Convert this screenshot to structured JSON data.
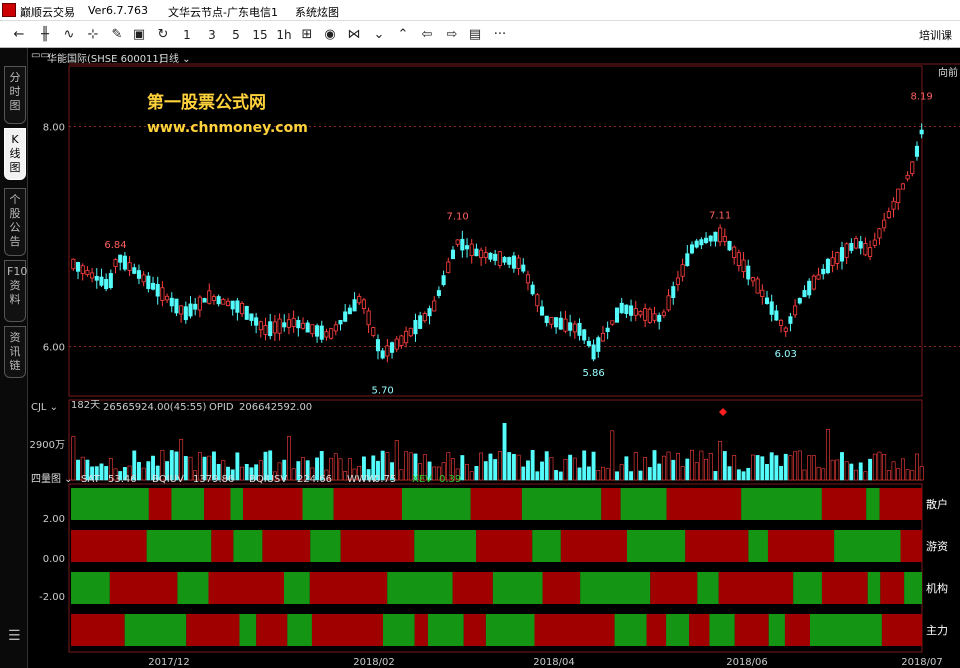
{
  "window": {
    "app_name": "巅顺云交易",
    "version": "Ver6.7.763",
    "server": "文华云节点-广东电信1",
    "theme_label": "系统炫图"
  },
  "toolbar": {
    "period_buttons": [
      "1",
      "3",
      "5",
      "15",
      "1h"
    ],
    "right_label": "培训课",
    "more_label": "···",
    "icons": [
      "back-icon",
      "candlestick-icon",
      "line-chart-icon",
      "crosshair-icon",
      "drawing-tool-icon",
      "save-icon",
      "refresh-icon",
      "period-1",
      "period-3",
      "period-5",
      "period-15",
      "period-1h",
      "grid-icon",
      "eye-icon",
      "bowtie-icon",
      "chevron-down-icon",
      "chevron-up-icon",
      "arrow-left-icon",
      "arrow-right-icon",
      "layout-icon",
      "more-icon"
    ]
  },
  "side_tabs": [
    {
      "label": "分时图",
      "active": false
    },
    {
      "label": "K线图",
      "active": true
    },
    {
      "label": "个股公告",
      "active": false
    },
    {
      "label": "F10资料",
      "active": false
    },
    {
      "label": "资讯链",
      "active": false
    }
  ],
  "header": {
    "symbol": "华能国际(SHSE 600011)",
    "period": "日线",
    "right_label": "向前"
  },
  "watermark": {
    "line1": "第一股票公式网",
    "line2": "www.chnmoney.com"
  },
  "price_panel": {
    "y_ticks": [
      "8.00",
      "6.00"
    ],
    "days_label": "182天",
    "annotations_high": [
      "6.84",
      "7.10",
      "7.11",
      "8.19"
    ],
    "annotations_low": [
      "5.70",
      "5.86",
      "6.03"
    ]
  },
  "volume_panel": {
    "title": "CJL",
    "value": "26565924.00(45:55)",
    "opid_label": "OPID",
    "opid_value": "206642592.00",
    "y_tick": "2900万"
  },
  "indicator_panel": {
    "title": "四量图",
    "items": [
      {
        "name": "SAT",
        "value": "53.46"
      },
      {
        "name": "BQIUV",
        "value": "1379.86"
      },
      {
        "name": "BQIUSV",
        "value": "224.66"
      },
      {
        "name": "WWW",
        "value": "0.75"
      },
      {
        "name": "XEV",
        "value": "0.39"
      }
    ],
    "y_ticks": [
      "2.00",
      "0.00",
      "-2.00"
    ],
    "band_labels": [
      "散户",
      "游资",
      "机构",
      "主力"
    ]
  },
  "x_axis": {
    "labels": [
      "2017/12",
      "2018/02",
      "2018/04",
      "2018/06",
      "2018/07"
    ]
  },
  "colors": {
    "up": "#ff4040",
    "down": "#54fcfc",
    "band_green": "#149614",
    "band_red": "#a00000",
    "watermark": "#ffd23c"
  },
  "chart_data": {
    "type": "candlestick",
    "bar_count": 182,
    "price_ylim": [
      5.7,
      8.19
    ],
    "key_points": [
      {
        "label": "6.84",
        "value": 6.84
      },
      {
        "label": "5.70",
        "value": 5.7
      },
      {
        "label": "7.10",
        "value": 7.1
      },
      {
        "label": "5.86",
        "value": 5.86
      },
      {
        "label": "7.11",
        "value": 7.11
      },
      {
        "label": "6.03",
        "value": 6.03
      },
      {
        "label": "8.19",
        "value": 8.19
      }
    ],
    "price_path_anchors": [
      [
        0,
        6.75
      ],
      [
        9,
        6.55
      ],
      [
        11,
        6.82
      ],
      [
        28,
        6.3
      ],
      [
        34,
        6.45
      ],
      [
        42,
        6.35
      ],
      [
        48,
        6.15
      ],
      [
        55,
        6.22
      ],
      [
        64,
        6.1
      ],
      [
        72,
        6.45
      ],
      [
        77,
        5.92
      ],
      [
        83,
        6.08
      ],
      [
        90,
        6.35
      ],
      [
        96,
        6.95
      ],
      [
        101,
        6.85
      ],
      [
        112,
        6.75
      ],
      [
        118,
        6.25
      ],
      [
        127,
        6.15
      ],
      [
        130,
        5.95
      ],
      [
        137,
        6.35
      ],
      [
        147,
        6.25
      ],
      [
        155,
        6.92
      ],
      [
        162,
        7.02
      ],
      [
        171,
        6.55
      ],
      [
        178,
        6.15
      ],
      [
        182,
        6.45
      ],
      [
        189,
        6.75
      ],
      [
        196,
        6.95
      ],
      [
        199,
        6.85
      ],
      [
        210,
        7.65
      ],
      [
        212,
        7.95
      ]
    ],
    "bands": [
      {
        "name": "散户",
        "segments": [
          [
            0,
            0.076,
            "g"
          ],
          [
            0.076,
            0.376,
            "r"
          ],
          [
            0.376,
            0.601,
            "g"
          ],
          [
            0.601,
            0.669,
            "r"
          ],
          [
            0.669,
            0.756,
            "g"
          ],
          [
            0.756,
            0.837,
            "r"
          ],
          [
            0.837,
            1,
            "g"
          ],
          [
            1,
            1.2,
            "r"
          ],
          [
            1.2,
            1.281,
            "g"
          ],
          [
            1.281,
            1.376,
            "r"
          ],
          [
            1.376,
            1.401,
            "g"
          ],
          [
            1.401,
            1.506,
            "r"
          ],
          [
            1.506,
            1.6,
            "g"
          ],
          [
            1.6,
            1.92,
            "r"
          ],
          [
            1.92,
            1.95,
            "g"
          ],
          [
            1.95,
            1.99,
            "r"
          ],
          [
            1.99,
            2.05,
            "g"
          ],
          [
            2.05,
            2.24,
            "r"
          ],
          [
            2.24,
            2.59,
            "g"
          ],
          [
            2.59,
            2.76,
            "r"
          ]
        ]
      },
      {
        "name": "游资",
        "segments": [
          [
            0,
            0.04,
            "g"
          ],
          [
            0.04,
            0.065,
            "r"
          ],
          [
            0.065,
            0.085,
            "g"
          ],
          [
            0.085,
            0.16,
            "r"
          ],
          [
            0.16,
            0.323,
            "g"
          ],
          [
            0.323,
            0.343,
            "r"
          ],
          [
            0.343,
            0.43,
            "g"
          ],
          [
            0.43,
            0.5,
            "r"
          ],
          [
            0.5,
            0.53,
            "g"
          ],
          [
            0.53,
            0.58,
            "r"
          ]
        ]
      },
      {
        "name": "机构",
        "segments": []
      },
      {
        "name": "主力",
        "segments": []
      }
    ]
  }
}
